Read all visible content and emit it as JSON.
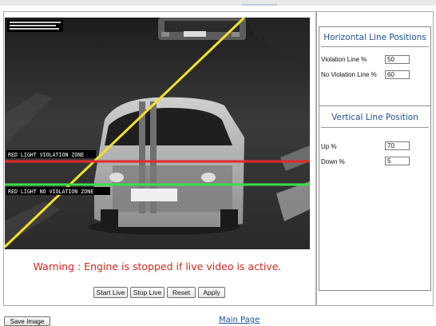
{
  "camera": {
    "overlay_zone_top": "RED LIGHT VIOLATION ZONE",
    "overlay_zone_bottom": "RED LIGHT NO VIOLATION ZONE",
    "plate_text": "EB-8355",
    "colors": {
      "violation_line": "#e02a2a",
      "no_violation_line": "#3ddc4a",
      "diagonal_line": "#f2e02a"
    }
  },
  "warning": "Warning : Engine is stopped if live video is active.",
  "buttons": {
    "start_live": "Start Live",
    "stop_live": "Stop Live",
    "reset": "Reset",
    "apply": "Apply"
  },
  "horizontal": {
    "title": "Horizontal Line Positions",
    "violation_label": "Violation Line %",
    "violation_value": "50",
    "no_violation_label": "No Violation Line %",
    "no_violation_value": "60"
  },
  "vertical": {
    "title": "Vertical Line Position",
    "up_label": "Up %",
    "up_value": "70",
    "down_label": "Down %",
    "down_value": "5"
  },
  "footer": {
    "save_image": "Save Image",
    "main_page": "Main Page"
  },
  "colors": {
    "accent": "#1f4f9a",
    "warning": "#d02a1f"
  }
}
